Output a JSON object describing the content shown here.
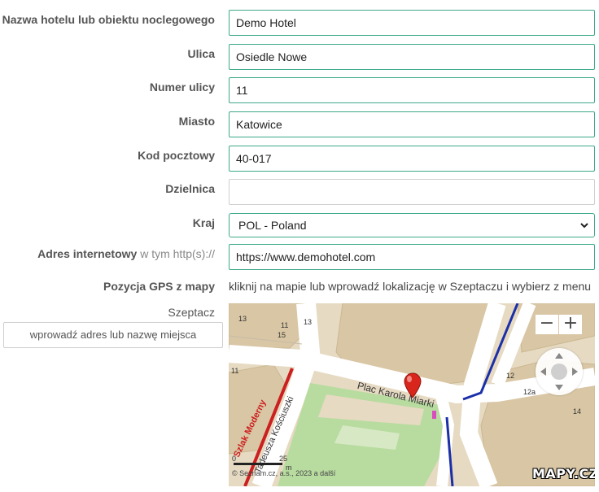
{
  "form": {
    "hotel_name": {
      "label": "Nazwa hotelu lub obiektu noclegowego",
      "value": "Demo Hotel"
    },
    "street": {
      "label": "Ulica",
      "value": "Osiedle Nowe"
    },
    "street_number": {
      "label": "Numer ulicy",
      "value": "11"
    },
    "city": {
      "label": "Miasto",
      "value": "Katowice"
    },
    "postal_code": {
      "label": "Kod pocztowy",
      "value": "40-017"
    },
    "district": {
      "label": "Dzielnica",
      "value": ""
    },
    "country": {
      "label": "Kraj",
      "value": "POL - Poland"
    },
    "website": {
      "label": "Adres internetowy",
      "hint": "w tym http(s)://",
      "value": "https://www.demohotel.com"
    },
    "gps": {
      "label": "Pozycja GPS z mapy",
      "instruction": "kliknij na mapie lub wprowadź lokalizację w Szeptaczu i wybierz z menu"
    },
    "whisperer": {
      "label": "Szeptacz",
      "placeholder": "wprowadź adres lub nazwę miejsca"
    }
  },
  "map": {
    "street_labels": [
      "Plac Karola Miarki",
      "Szlak Moderny",
      "Tadeusza Kościuszki"
    ],
    "house_numbers": [
      "13",
      "11",
      "13",
      "15",
      "11",
      "12",
      "12a",
      "14"
    ],
    "zoom_in": "+",
    "zoom_out": "−",
    "scale_labels": [
      "0",
      "25",
      "m"
    ],
    "attribution": "© Seznam.cz, a.s., 2023 a další",
    "logo": "MAPY.CZ",
    "colors": {
      "building": "#d8c6a4",
      "ground": "#e6dac3",
      "road": "#ffffff",
      "park": "#b8dba0",
      "marker": "#d9261c",
      "route_blue": "#1a2fa8",
      "route_red": "#cc1f1f"
    }
  }
}
